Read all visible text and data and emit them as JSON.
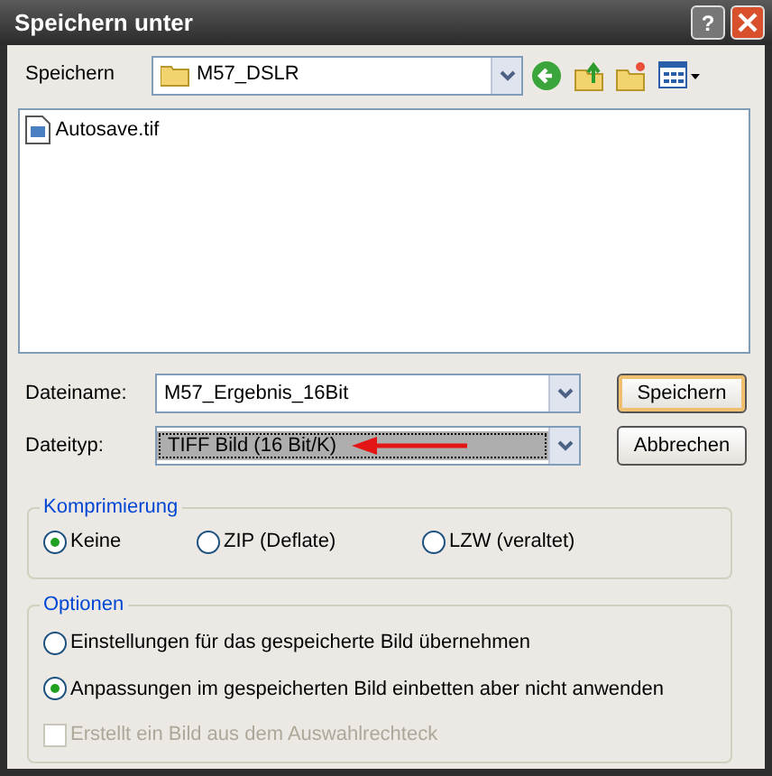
{
  "window": {
    "title": "Speichern unter",
    "help": "?"
  },
  "location": {
    "label": "Speichern",
    "value": "M57_DSLR"
  },
  "files": [
    {
      "name": "Autosave.tif",
      "selected": false
    }
  ],
  "filename": {
    "label": "Dateiname:",
    "value": "M57_Ergebnis_16Bit"
  },
  "filetype": {
    "label": "Dateityp:",
    "value": "TIFF Bild (16 Bit/K)",
    "selected": true
  },
  "buttons": [
    {
      "label": "Speichern",
      "default": true
    },
    {
      "label": "Abbrechen",
      "default": false
    }
  ],
  "compression": {
    "title": "Komprimierung",
    "options": [
      {
        "label": "Keine",
        "selected": true
      },
      {
        "label": "ZIP (Deflate)",
        "selected": false
      },
      {
        "label": "LZW (veraltet)",
        "selected": false
      }
    ]
  },
  "options": {
    "title": "Optionen",
    "items": [
      {
        "kind": "radio",
        "label": "Einstellungen für das gespeicherte Bild übernehmen",
        "selected": false,
        "disabled": false
      },
      {
        "kind": "radio",
        "label": "Anpassungen im gespeicherten Bild einbetten aber nicht anwenden",
        "selected": true,
        "disabled": false
      },
      {
        "kind": "checkbox",
        "label": "Erstellt ein Bild aus dem Auswahlrechteck",
        "checked": false,
        "disabled": true
      }
    ]
  }
}
